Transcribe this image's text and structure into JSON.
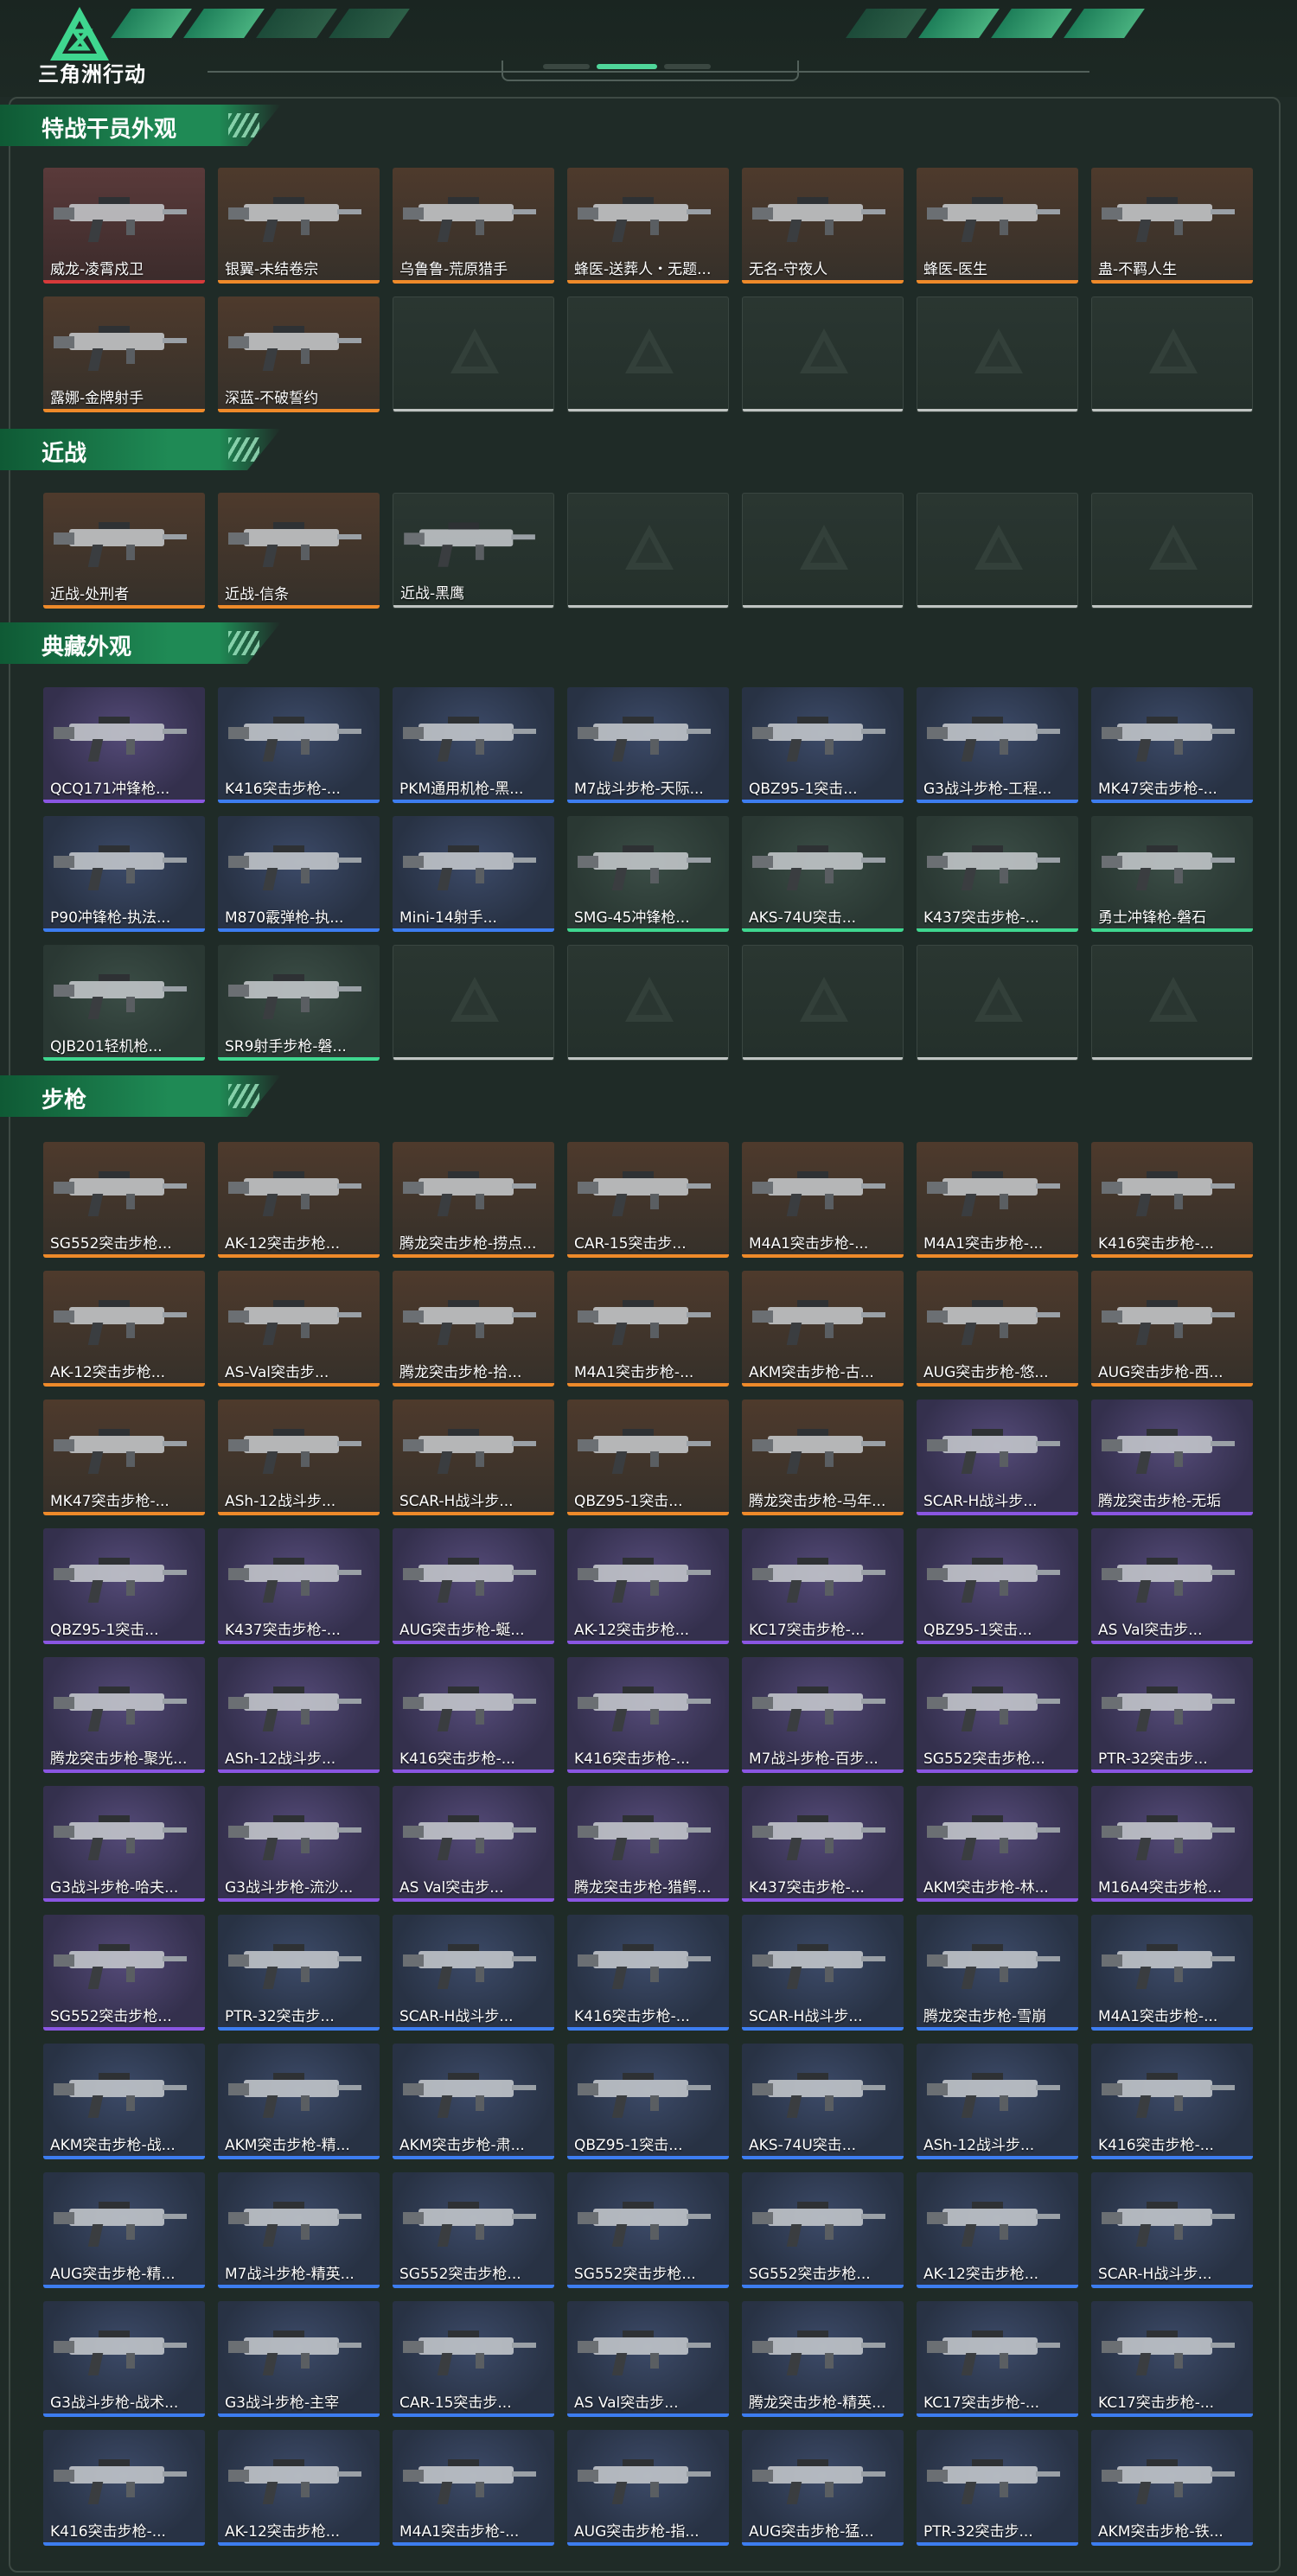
{
  "app": {
    "brand": "三角洲行动"
  },
  "sections": {
    "operators": {
      "title": "特战干员外观",
      "items": [
        {
          "label": "威龙-凌霄戍卫",
          "q": "red"
        },
        {
          "label": "银翼-未结卷宗",
          "q": "orange"
        },
        {
          "label": "乌鲁鲁-荒原猎手",
          "q": "orange"
        },
        {
          "label": "蜂医-送葬人・无题...",
          "q": "orange"
        },
        {
          "label": "无名-守夜人",
          "q": "orange"
        },
        {
          "label": "蜂医-医生",
          "q": "orange"
        },
        {
          "label": "蛊-不羁人生",
          "q": "orange"
        },
        {
          "label": "露娜-金牌射手",
          "q": "orange"
        },
        {
          "label": "深蓝-不破誓约",
          "q": "orange"
        },
        {
          "label": "",
          "q": "empty"
        },
        {
          "label": "",
          "q": "empty"
        },
        {
          "label": "",
          "q": "empty"
        },
        {
          "label": "",
          "q": "empty"
        },
        {
          "label": "",
          "q": "empty"
        }
      ]
    },
    "melee": {
      "title": "近战",
      "items": [
        {
          "label": "近战-处刑者",
          "q": "orange"
        },
        {
          "label": "近战-信条",
          "q": "orange"
        },
        {
          "label": "近战-黑鹰",
          "q": "empty-lbl"
        },
        {
          "label": "",
          "q": "empty"
        },
        {
          "label": "",
          "q": "empty"
        },
        {
          "label": "",
          "q": "empty"
        },
        {
          "label": "",
          "q": "empty"
        }
      ]
    },
    "collection": {
      "title": "典藏外观",
      "items": [
        {
          "label": "QCQ171冲锋枪...",
          "q": "purple"
        },
        {
          "label": "K416突击步枪-...",
          "q": "blue"
        },
        {
          "label": "PKM通用机枪-黑...",
          "q": "blue"
        },
        {
          "label": "M7战斗步枪-天际...",
          "q": "blue"
        },
        {
          "label": "QBZ95-1突击...",
          "q": "blue"
        },
        {
          "label": "G3战斗步枪-工程...",
          "q": "blue"
        },
        {
          "label": "MK47突击步枪-...",
          "q": "blue"
        },
        {
          "label": "P90冲锋枪-执法...",
          "q": "blue"
        },
        {
          "label": "M870霰弹枪-执...",
          "q": "blue"
        },
        {
          "label": "Mini-14射手...",
          "q": "blue"
        },
        {
          "label": "SMG-45冲锋枪...",
          "q": "green"
        },
        {
          "label": "AKS-74U突击...",
          "q": "green"
        },
        {
          "label": "K437突击步枪-...",
          "q": "green"
        },
        {
          "label": "勇士冲锋枪-磐石",
          "q": "green"
        },
        {
          "label": "QJB201轻机枪...",
          "q": "green"
        },
        {
          "label": "SR9射手步枪-磐...",
          "q": "green"
        },
        {
          "label": "",
          "q": "empty"
        },
        {
          "label": "",
          "q": "empty"
        },
        {
          "label": "",
          "q": "empty"
        },
        {
          "label": "",
          "q": "empty"
        },
        {
          "label": "",
          "q": "empty"
        }
      ]
    },
    "rifles": {
      "title": "步枪",
      "items": [
        {
          "label": "SG552突击步枪...",
          "q": "orange"
        },
        {
          "label": "AK-12突击步枪...",
          "q": "orange"
        },
        {
          "label": "腾龙突击步枪-捞点...",
          "q": "orange"
        },
        {
          "label": "CAR-15突击步...",
          "q": "orange"
        },
        {
          "label": "M4A1突击步枪-...",
          "q": "orange"
        },
        {
          "label": "M4A1突击步枪-...",
          "q": "orange"
        },
        {
          "label": "K416突击步枪-...",
          "q": "orange"
        },
        {
          "label": "AK-12突击步枪...",
          "q": "orange"
        },
        {
          "label": "AS-Val突击步...",
          "q": "orange"
        },
        {
          "label": "腾龙突击步枪-拾...",
          "q": "orange"
        },
        {
          "label": "M4A1突击步枪-...",
          "q": "orange"
        },
        {
          "label": "AKM突击步枪-古...",
          "q": "orange"
        },
        {
          "label": "AUG突击步枪-悠...",
          "q": "orange"
        },
        {
          "label": "AUG突击步枪-西...",
          "q": "orange"
        },
        {
          "label": "MK47突击步枪-...",
          "q": "orange"
        },
        {
          "label": "ASh-12战斗步...",
          "q": "orange"
        },
        {
          "label": "SCAR-H战斗步...",
          "q": "orange"
        },
        {
          "label": "QBZ95-1突击...",
          "q": "orange"
        },
        {
          "label": "腾龙突击步枪-马年...",
          "q": "orange"
        },
        {
          "label": "SCAR-H战斗步...",
          "q": "purple"
        },
        {
          "label": "腾龙突击步枪-无垢",
          "q": "purple"
        },
        {
          "label": "QBZ95-1突击...",
          "q": "purple"
        },
        {
          "label": "K437突击步枪-...",
          "q": "purple"
        },
        {
          "label": "AUG突击步枪-蜒...",
          "q": "purple"
        },
        {
          "label": "AK-12突击步枪...",
          "q": "purple"
        },
        {
          "label": "KC17突击步枪-...",
          "q": "purple"
        },
        {
          "label": "QBZ95-1突击...",
          "q": "purple"
        },
        {
          "label": "AS Val突击步...",
          "q": "purple"
        },
        {
          "label": "腾龙突击步枪-聚光...",
          "q": "purple"
        },
        {
          "label": "ASh-12战斗步...",
          "q": "purple"
        },
        {
          "label": "K416突击步枪-...",
          "q": "purple"
        },
        {
          "label": "K416突击步枪-...",
          "q": "purple"
        },
        {
          "label": "M7战斗步枪-百步...",
          "q": "purple"
        },
        {
          "label": "SG552突击步枪...",
          "q": "purple"
        },
        {
          "label": "PTR-32突击步...",
          "q": "purple"
        },
        {
          "label": "G3战斗步枪-哈夫...",
          "q": "purple"
        },
        {
          "label": "G3战斗步枪-流沙...",
          "q": "purple"
        },
        {
          "label": "AS Val突击步...",
          "q": "purple"
        },
        {
          "label": "腾龙突击步枪-猎鳄...",
          "q": "purple"
        },
        {
          "label": "K437突击步枪-...",
          "q": "purple"
        },
        {
          "label": "AKM突击步枪-林...",
          "q": "purple"
        },
        {
          "label": "M16A4突击步枪...",
          "q": "purple"
        },
        {
          "label": "SG552突击步枪...",
          "q": "purple"
        },
        {
          "label": "PTR-32突击步...",
          "q": "blue"
        },
        {
          "label": "SCAR-H战斗步...",
          "q": "blue"
        },
        {
          "label": "K416突击步枪-...",
          "q": "blue"
        },
        {
          "label": "SCAR-H战斗步...",
          "q": "blue"
        },
        {
          "label": "腾龙突击步枪-雪崩",
          "q": "blue"
        },
        {
          "label": "M4A1突击步枪-...",
          "q": "blue"
        },
        {
          "label": "AKM突击步枪-战...",
          "q": "blue"
        },
        {
          "label": "AKM突击步枪-精...",
          "q": "blue"
        },
        {
          "label": "AKM突击步枪-肃...",
          "q": "blue"
        },
        {
          "label": "QBZ95-1突击...",
          "q": "blue"
        },
        {
          "label": "AKS-74U突击...",
          "q": "blue"
        },
        {
          "label": "ASh-12战斗步...",
          "q": "blue"
        },
        {
          "label": "K416突击步枪-...",
          "q": "blue"
        },
        {
          "label": "AUG突击步枪-精...",
          "q": "blue"
        },
        {
          "label": "M7战斗步枪-精英...",
          "q": "blue"
        },
        {
          "label": "SG552突击步枪...",
          "q": "blue"
        },
        {
          "label": "SG552突击步枪...",
          "q": "blue"
        },
        {
          "label": "SG552突击步枪...",
          "q": "blue"
        },
        {
          "label": "AK-12突击步枪...",
          "q": "blue"
        },
        {
          "label": "SCAR-H战斗步...",
          "q": "blue"
        },
        {
          "label": "G3战斗步枪-战术...",
          "q": "blue"
        },
        {
          "label": "G3战斗步枪-主宰",
          "q": "blue"
        },
        {
          "label": "CAR-15突击步...",
          "q": "blue"
        },
        {
          "label": "AS Val突击步...",
          "q": "blue"
        },
        {
          "label": "腾龙突击步枪-精英...",
          "q": "blue"
        },
        {
          "label": "KC17突击步枪-...",
          "q": "blue"
        },
        {
          "label": "KC17突击步枪-...",
          "q": "blue"
        },
        {
          "label": "K416突击步枪-...",
          "q": "blue"
        },
        {
          "label": "AK-12突击步枪...",
          "q": "blue"
        },
        {
          "label": "M4A1突击步枪-...",
          "q": "blue"
        },
        {
          "label": "AUG突击步枪-指...",
          "q": "blue"
        },
        {
          "label": "AUG突击步枪-猛...",
          "q": "blue"
        },
        {
          "label": "PTR-32突击步...",
          "q": "blue"
        },
        {
          "label": "AKM突击步枪-铁...",
          "q": "blue"
        }
      ]
    }
  }
}
